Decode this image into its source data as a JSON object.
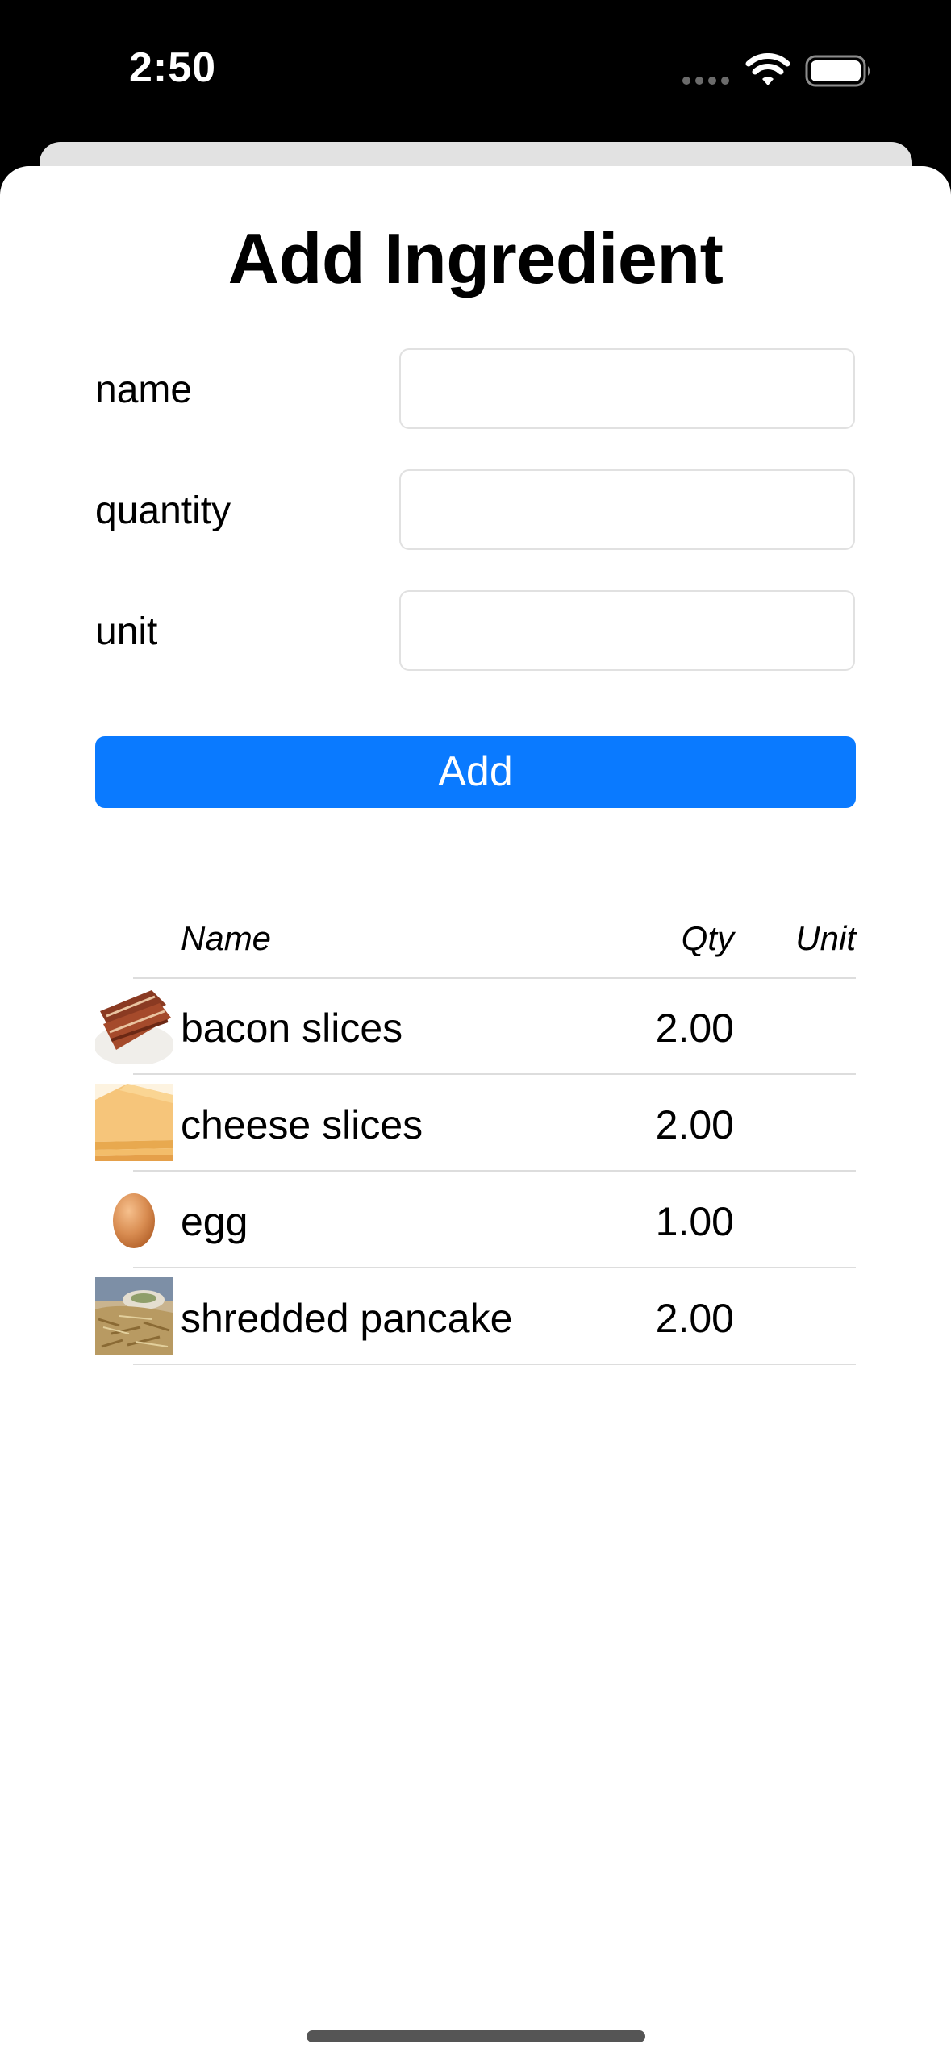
{
  "status_bar": {
    "time": "2:50"
  },
  "sheet": {
    "title": "Add Ingredient",
    "form": {
      "name_label": "name",
      "name_value": "",
      "quantity_label": "quantity",
      "quantity_value": "",
      "unit_label": "unit",
      "unit_value": ""
    },
    "add_button_label": "Add"
  },
  "table": {
    "headers": {
      "name": "Name",
      "qty": "Qty",
      "unit": "Unit"
    },
    "rows": [
      {
        "name": "bacon slices",
        "qty": "2.00",
        "unit": "",
        "icon": "bacon-thumbnail"
      },
      {
        "name": "cheese slices",
        "qty": "2.00",
        "unit": "",
        "icon": "cheese-thumbnail"
      },
      {
        "name": "egg",
        "qty": "1.00",
        "unit": "",
        "icon": "egg-thumbnail"
      },
      {
        "name": "shredded pancake",
        "qty": "2.00",
        "unit": "",
        "icon": "pancake-thumbnail"
      }
    ]
  },
  "colors": {
    "accent": "#0a7aff",
    "background": "#ffffff",
    "status_bar": "#000000"
  }
}
